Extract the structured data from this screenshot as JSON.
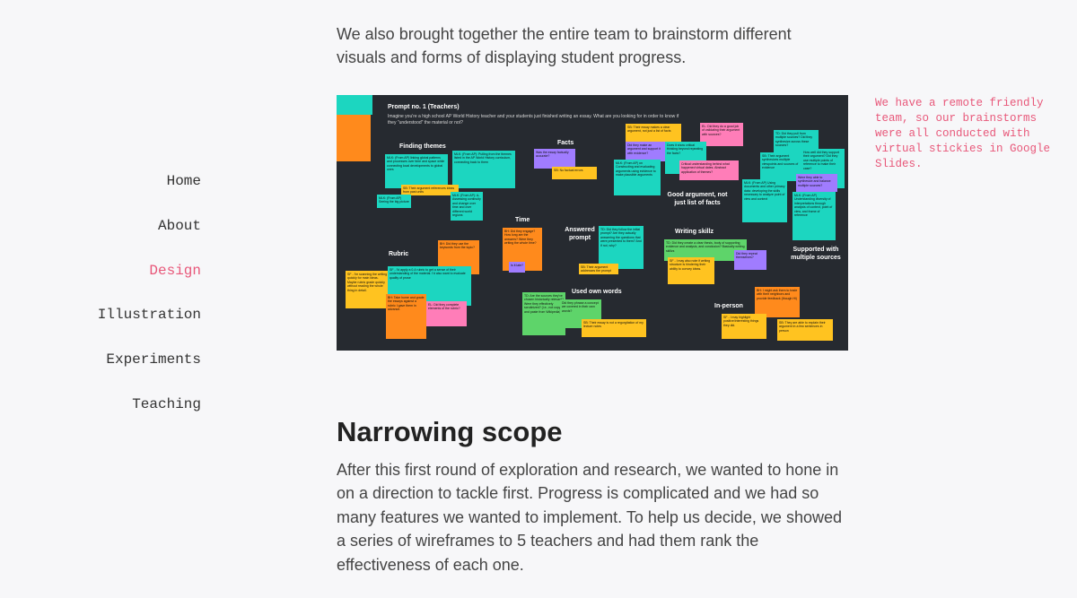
{
  "nav": {
    "items": [
      {
        "label": "Home",
        "active": false
      },
      {
        "label": "About",
        "active": false
      },
      {
        "label": "Design",
        "active": true
      },
      {
        "label": "Illustration",
        "active": false
      },
      {
        "label": "Experiments",
        "active": false
      },
      {
        "label": "Teaching",
        "active": false
      }
    ],
    "active_color": "#e8587a"
  },
  "content": {
    "intro": "We also brought together the entire team to brainstorm different visuals and forms of displaying student progress.",
    "side_note": "We have a remote friendly team, so our brainstorms were all conducted with virtual stickies in Google Slides.",
    "heading": "Narrowing scope",
    "paragraph": "After this first round of exploration and research, we wanted to hone in on a direction to tackle first. Progress is complicated and we had so many features we wanted to implement. To help us decide, we showed a series of wireframes to 5 teachers and had them rank the effectiveness of each one."
  },
  "board": {
    "title": "Prompt no. 1 (Teachers)",
    "subtitle": "Imagine you're a high school AP World History teacher and your students just finished writing an essay. What are you looking for in order to know if they \"understood\" the material or not?",
    "themes": [
      "Finding themes",
      "Facts",
      "Good argument, not just list of facts",
      "Time",
      "Answered prompt",
      "Writing skillz",
      "Rubric",
      "Used own words",
      "In-person",
      "Supported with multiple sources"
    ],
    "colors": {
      "background": "#262a30",
      "teal": "#1cd6c0",
      "orange": "#ff8a1c",
      "yellow": "#ffc320",
      "green": "#5ed46a",
      "purple": "#a07cff",
      "pink": "#ff7db8"
    },
    "notes": [
      {
        "color": "teal",
        "text": ""
      },
      {
        "color": "orange",
        "text": ""
      },
      {
        "color": "teal",
        "text": "MLK: (From AP) linking global patterns and processes over time and space while connecting local developments to global ones"
      },
      {
        "color": "teal",
        "text": "MLK: (From AP): Pulling from the themes listed in the AP World History curriculum, connecting back to them"
      },
      {
        "color": "yellow",
        "text": "SB: Their argument references ideas from past units"
      },
      {
        "color": "teal",
        "text": "MLK: (From AP): A-Assessing continuity and change over time and over different world regions"
      },
      {
        "color": "teal",
        "text": "MLK: (From AP) Seeing the big picture"
      },
      {
        "color": "purple",
        "text": "Was the essay factually accurate?"
      },
      {
        "color": "yellow",
        "text": "SB: No factual errors"
      },
      {
        "color": "yellow",
        "text": "SB: Their essay makes a clear argument, not just a list of facts"
      },
      {
        "color": "pink",
        "text": "EL: Did they do a good job of validating their argument with sources?"
      },
      {
        "color": "purple",
        "text": "Did they make an argument and support it with evidence?"
      },
      {
        "color": "teal",
        "text": "Does it show critical thinking beyond repeating the facts?"
      },
      {
        "color": "teal",
        "text": "MLK: (From AP) on Constructing and evaluating arguments using evidence to make plausible arguments"
      },
      {
        "color": "pink",
        "text": "Critical understanding behind what happened virtual dates. Abstract application of themes?"
      },
      {
        "color": "teal",
        "text": "TD: Did they pull from multiple sources? Did they synthesize across these sources?"
      },
      {
        "color": "teal",
        "text": "SB: Their argument synthesizes multiple viewpoints and sources of evidence"
      },
      {
        "color": "teal",
        "text": "How well did they support their argument? Did they use multiple points of reference to make their case?"
      },
      {
        "color": "teal",
        "text": "MLK: (From AP) Using documents and other primary data: developing the skills necessary to analyze point of view and context"
      },
      {
        "color": "purple",
        "text": "Were they able to synthesize and balance multiple sources?"
      },
      {
        "color": "teal",
        "text": "MLK: (From AP) Understanding diversity of interpretations through analysis of context, point of view, and frame of reference"
      },
      {
        "color": "orange",
        "text": "BH: Did they engage? How long are the answers? Were they writing the whole time?"
      },
      {
        "color": "orange",
        "text": "BH: Did they use the keywords from the topic?"
      },
      {
        "color": "teal",
        "text": "TD: Did they follow the initial prompt? Are they actually answering the questions that were presented to them? And if not, why?"
      },
      {
        "color": "yellow",
        "text": "SB: Their argument addresses the prompt"
      },
      {
        "color": "purple",
        "text": "Is it late?"
      },
      {
        "color": "green",
        "text": "TD: Did they create a clear thesis, body of supporting evidence and analysis, and conclusion? Basically writing skillzs"
      },
      {
        "color": "yellow",
        "text": "SF - I may also note if writing structure is hindering their ability to convey ideas."
      },
      {
        "color": "purple",
        "text": "Did they repeat themselves?"
      },
      {
        "color": "yellow",
        "text": "SF - I'm scanning the writing quickly for main ideas. Maybe rubric grade quickly without reading the whole thing in detail."
      },
      {
        "color": "teal",
        "text": "SF - I'd apply a 0-4 rubric to get a sense of their understanding of the material. I'd also want to evaluate quality of prose"
      },
      {
        "color": "orange",
        "text": "BH: Take home and grade the essays against a rubric I gave them in advance."
      },
      {
        "color": "pink",
        "text": "EL: Did they complete elements of the rubric?"
      },
      {
        "color": "green",
        "text": "TD: Are the sources they've chosen historically relevant? Were they effectively scrutinized? (i.e., not copy and paste from Wikipedia)"
      },
      {
        "color": "green",
        "text": "Did they phrase a concept we covered in their own words?"
      },
      {
        "color": "yellow",
        "text": "SB: Their essay is not a regurgitation of my lecture notes"
      },
      {
        "color": "orange",
        "text": "BH: I might ask them to trade with their neighbors and provide feedback (though Hi)"
      },
      {
        "color": "yellow",
        "text": "SF - I may highlight positive/interesting things they did."
      },
      {
        "color": "yellow",
        "text": "SB: They are able to explain their argument in a few sentences in person"
      }
    ]
  }
}
